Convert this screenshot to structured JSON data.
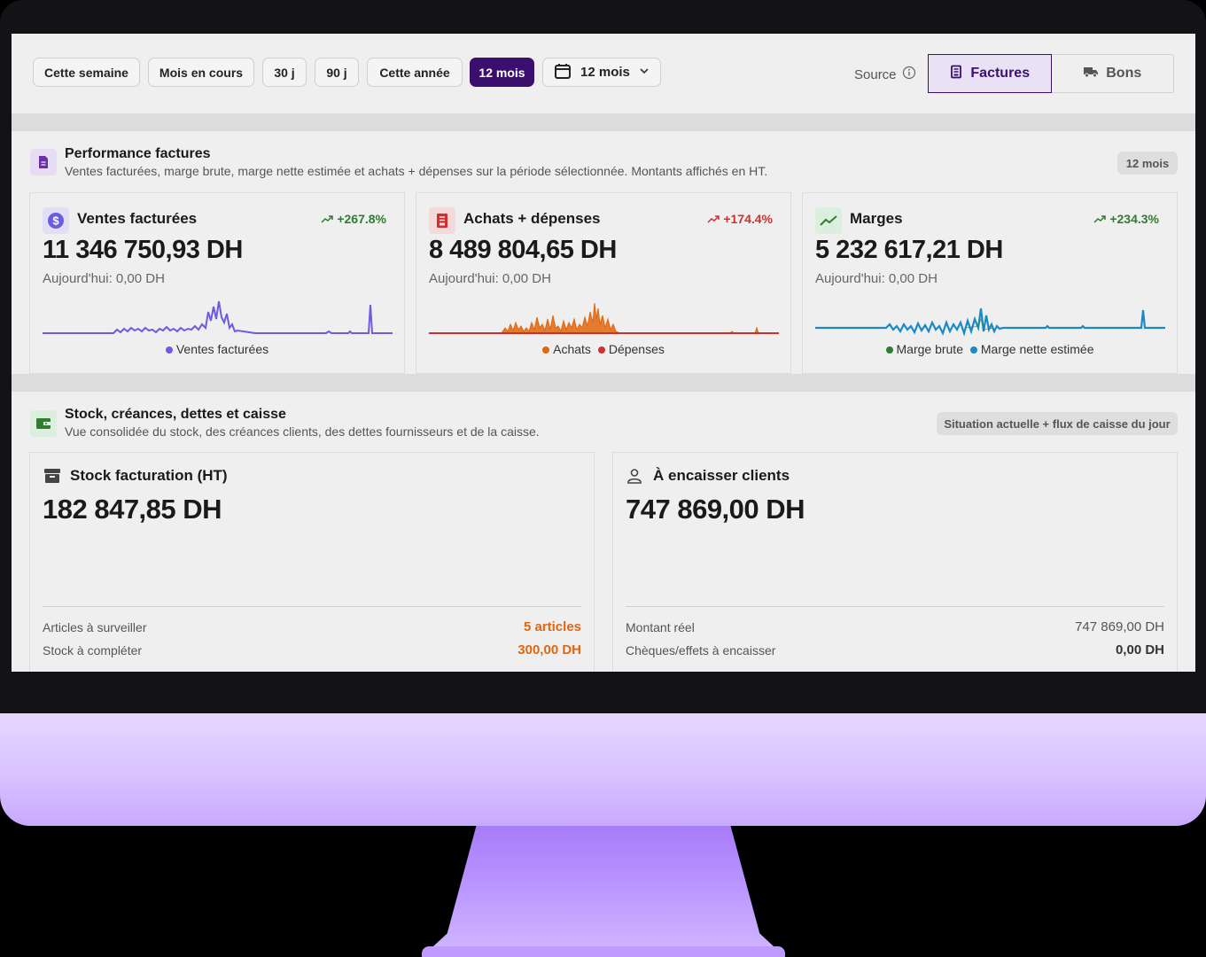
{
  "toolbar": {
    "periods": [
      "Cette semaine",
      "Mois en cours",
      "30 j",
      "90 j",
      "Cette année",
      "12 mois"
    ],
    "active_period": "12 mois",
    "date_select": "12 mois",
    "source_label": "Source",
    "source_options": [
      "Factures",
      "Bons"
    ],
    "active_source": "Factures"
  },
  "performance": {
    "title": "Performance factures",
    "subtitle": "Ventes facturées, marge brute, marge nette estimée et achats + dépenses sur la période sélectionnée. Montants affichés en HT.",
    "tag": "12 mois",
    "cards": [
      {
        "title": "Ventes facturées",
        "trend": "+267.8%",
        "value": "11 346 750,93 DH",
        "today": "Aujourd'hui: 0,00 DH",
        "legend": [
          "Ventes facturées"
        ]
      },
      {
        "title": "Achats + dépenses",
        "trend": "+174.4%",
        "value": "8 489 804,65 DH",
        "today": "Aujourd'hui: 0,00 DH",
        "legend": [
          "Achats",
          "Dépenses"
        ]
      },
      {
        "title": "Marges",
        "trend": "+234.3%",
        "value": "5 232 617,21 DH",
        "today": "Aujourd'hui: 0,00 DH",
        "legend": [
          "Marge brute",
          "Marge nette estimée"
        ]
      }
    ]
  },
  "stock": {
    "title": "Stock, créances, dettes et caisse",
    "subtitle": "Vue consolidée du stock, des créances clients, des dettes fournisseurs et de la caisse.",
    "tag": "Situation actuelle + flux de caisse du jour",
    "cards": [
      {
        "title": "Stock facturation (HT)",
        "value": "182 847,85 DH",
        "rows": [
          {
            "label": "Articles à surveiller",
            "value": "5 articles"
          },
          {
            "label": "Stock à compléter",
            "value": "300,00 DH"
          }
        ]
      },
      {
        "title": "À encaisser clients",
        "value": "747 869,00 DH",
        "rows": [
          {
            "label": "Montant réel",
            "value": "747 869,00 DH"
          },
          {
            "label": "Chèques/effets à encaisser",
            "value": "0,00 DH"
          }
        ]
      }
    ]
  },
  "colors": {
    "accent": "#3b0f6e",
    "ventes": "#6b5ce0",
    "achats": "#e0660f",
    "depenses": "#d12f2f",
    "marge_brute": "#2e7d32",
    "marge_nette": "#1b8ac4",
    "trend_up": "#2e7d32",
    "trend_red": "#d12f2f",
    "warning": "#e0660f"
  },
  "icons": [
    "calendar-icon",
    "chevron-down-icon",
    "info-icon",
    "receipt-icon",
    "truck-icon",
    "document-icon",
    "dollar-icon",
    "invoice-icon",
    "trending-up-icon",
    "wallet-icon",
    "archive-icon",
    "user-icon"
  ]
}
